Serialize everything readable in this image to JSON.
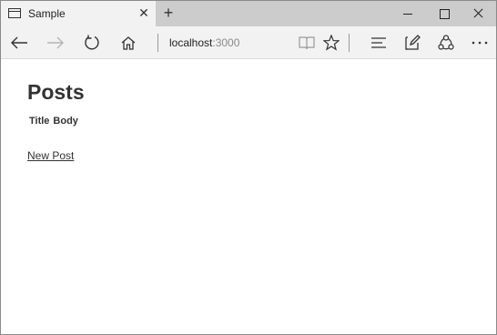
{
  "browser": {
    "tab_title": "Sample",
    "tab_close_glyph": "✕",
    "new_tab_glyph": "+",
    "address_host": "localhost",
    "address_port": ":3000"
  },
  "page": {
    "title": "Posts",
    "columns": [
      "Title",
      "Body"
    ],
    "new_post_link": "New Post"
  },
  "icons": {
    "back": "arrow-left-icon",
    "forward": "arrow-right-icon",
    "refresh": "refresh-icon",
    "home": "home-icon",
    "reading_view": "book-icon",
    "favorite": "star-icon",
    "hub": "hub-lines-icon",
    "web_note": "pen-note-icon",
    "share": "share-icon",
    "more": "more-dots-icon"
  },
  "colors": {
    "tab_bar": "#cccccc",
    "active_tab": "#f2f2f2",
    "text": "#333333",
    "port_text": "#8a8a8a"
  }
}
